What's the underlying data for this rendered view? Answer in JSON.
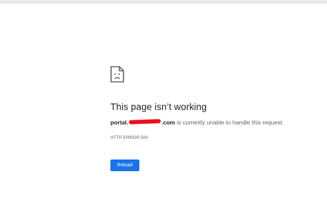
{
  "error_page": {
    "icon": "sad-page-icon",
    "heading": "This page isn’t working",
    "message": {
      "domain_prefix": "portal.",
      "domain_suffix": ".com",
      "text": " is currently unable to handle this request."
    },
    "error_code": "HTTP ERROR 500",
    "reload_label": "Reload"
  },
  "colors": {
    "heading": "#202124",
    "body_text": "#5f6368",
    "button": "#1a73e8",
    "redaction": "#e8121b"
  }
}
